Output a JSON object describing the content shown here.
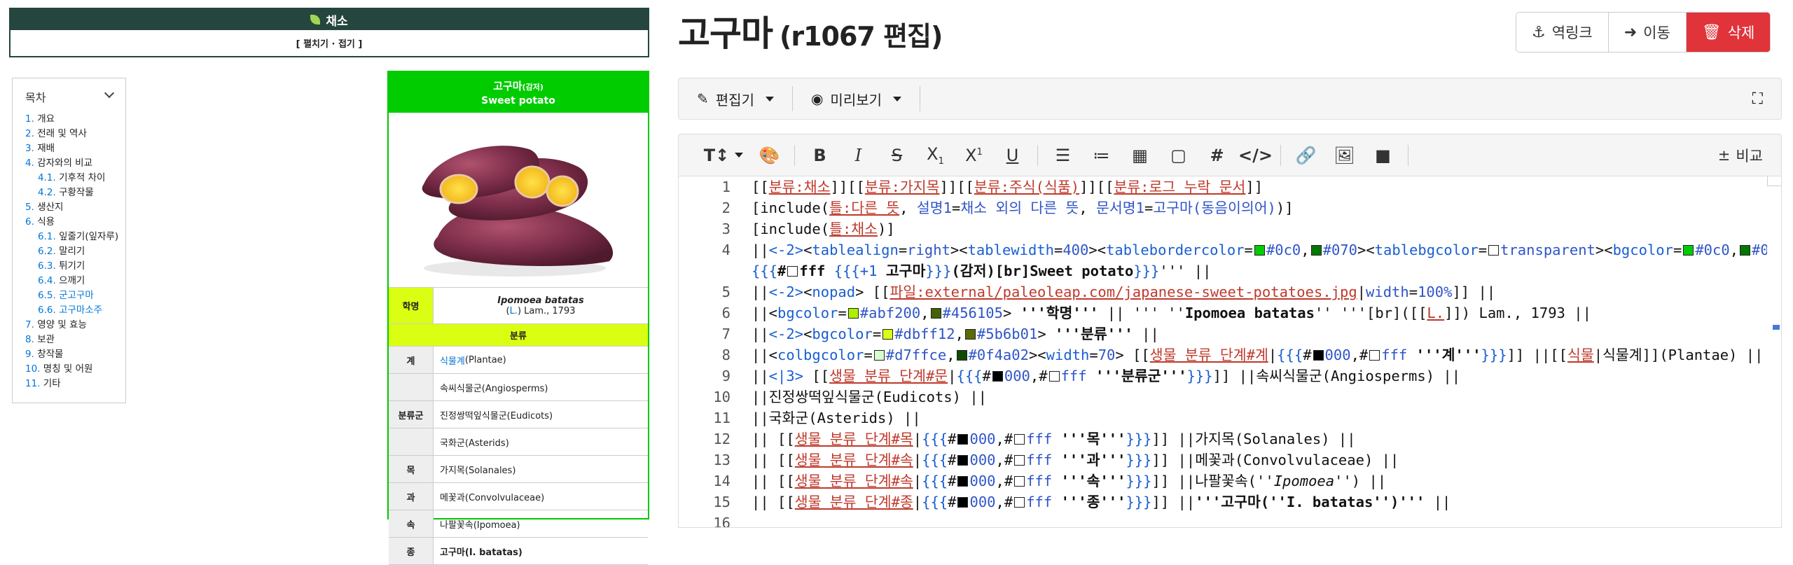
{
  "category_box": {
    "title": "채소",
    "toggle": "[ 펼치기 · 접기 ]"
  },
  "toc": {
    "title": "목차",
    "items": [
      {
        "num": "1.",
        "label": "개요",
        "level": 1
      },
      {
        "num": "2.",
        "label": "전래 및 역사",
        "level": 1
      },
      {
        "num": "3.",
        "label": "재배",
        "level": 1
      },
      {
        "num": "4.",
        "label": "감자와의 비교",
        "level": 1
      },
      {
        "num": "4.1.",
        "label": "기후적 차이",
        "level": 2
      },
      {
        "num": "4.2.",
        "label": "구황작물",
        "level": 2
      },
      {
        "num": "5.",
        "label": "생산지",
        "level": 1
      },
      {
        "num": "6.",
        "label": "식용",
        "level": 1
      },
      {
        "num": "6.1.",
        "label": "잎줄기(잎자루)",
        "level": 2
      },
      {
        "num": "6.2.",
        "label": "말리기",
        "level": 2
      },
      {
        "num": "6.3.",
        "label": "튀기기",
        "level": 2
      },
      {
        "num": "6.4.",
        "label": "으깨기",
        "level": 2
      },
      {
        "num": "6.5.",
        "label": "군고구마",
        "level": 2,
        "link": true
      },
      {
        "num": "6.6.",
        "label": "고구마소주",
        "level": 2,
        "link": true
      },
      {
        "num": "7.",
        "label": "영양 및 효능",
        "level": 1
      },
      {
        "num": "8.",
        "label": "보관",
        "level": 1
      },
      {
        "num": "9.",
        "label": "창작물",
        "level": 1
      },
      {
        "num": "10.",
        "label": "명칭 및 어원",
        "level": 1
      },
      {
        "num": "11.",
        "label": "기타",
        "level": 1
      }
    ]
  },
  "infobox": {
    "title": "고구마",
    "title_small": "(감저)",
    "subtitle": "Sweet potato",
    "sci_label": "학명",
    "sci_name": "Ipomoea batatas",
    "sci_author": "(L.) Lam., 1793",
    "sci_author_link": "L.",
    "section": "분류",
    "rows": [
      {
        "label": "계",
        "value": "식물계(Plantae)",
        "link": "식물계"
      },
      {
        "label": "",
        "value": "속씨식물군(Angiosperms)"
      },
      {
        "label": "분류군",
        "value": "진정쌍떡잎식물군(Eudicots)"
      },
      {
        "label": "",
        "value": "국화군(Asterids)"
      },
      {
        "label": "목",
        "value": "가지목(Solanales)"
      },
      {
        "label": "과",
        "value": "메꽃과(Convolvulaceae)"
      },
      {
        "label": "속",
        "value": "나팔꽃속(Ipomoea)"
      },
      {
        "label": "종",
        "value": "고구마(I. batatas)"
      }
    ]
  },
  "editor": {
    "title": "고구마",
    "title_sub": "(r1067 편집)",
    "actions": [
      {
        "icon": "anchor-icon",
        "glyph": "⚓",
        "label": "역링크"
      },
      {
        "icon": "arrow-right-circle-icon",
        "glyph": "➜",
        "label": "이동"
      },
      {
        "icon": "trash-icon",
        "glyph": "🗑",
        "label": "삭제"
      }
    ],
    "modes": [
      {
        "icon": "edit-icon",
        "glyph": "✎",
        "label": "편집기"
      },
      {
        "icon": "eye-icon",
        "glyph": "◉",
        "label": "미리보기"
      }
    ],
    "compare_label": "비교",
    "colors": {
      "danger": "#e0333a",
      "link": "#0275d8",
      "infobox_green": "#00cc00",
      "infobox_yellow": "#dbff12",
      "veg_dark": "#24463e"
    }
  },
  "code": {
    "line_numbers": [
      "1",
      "2",
      "3",
      "4",
      "",
      "5",
      "6",
      "7",
      "8",
      "9",
      "10",
      "11",
      "12",
      "13",
      "14",
      "15",
      "16"
    ]
  }
}
